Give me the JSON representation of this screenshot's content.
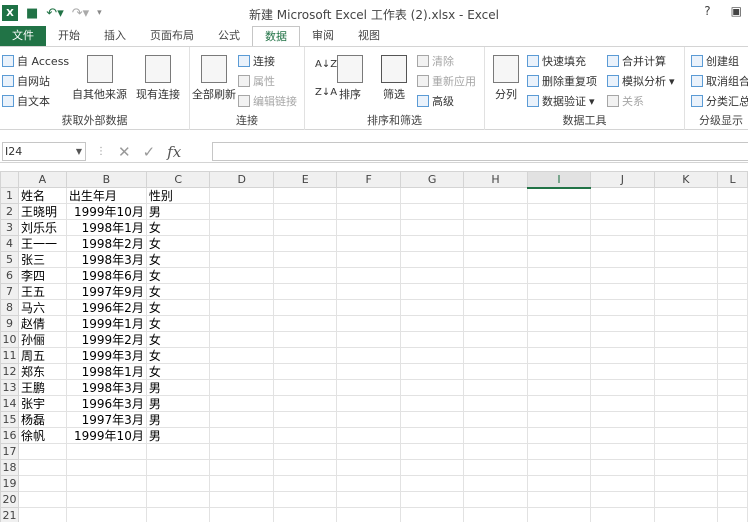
{
  "window": {
    "title": "新建 Microsoft Excel 工作表 (2).xlsx - Excel",
    "help": "?",
    "min_icon": "minimize-icon"
  },
  "tabs": [
    {
      "label": "文件"
    },
    {
      "label": "开始"
    },
    {
      "label": "插入"
    },
    {
      "label": "页面布局"
    },
    {
      "label": "公式"
    },
    {
      "label": "数据"
    },
    {
      "label": "审阅"
    },
    {
      "label": "视图"
    }
  ],
  "ribbon": {
    "ext_data": {
      "access": "自 Access",
      "web": "自网站",
      "text": "自文本",
      "other": "自其他来源",
      "existing": "现有连接",
      "label": "获取外部数据"
    },
    "connections": {
      "refresh": "全部刷新",
      "connections": "连接",
      "props": "属性",
      "edit_links": "编辑链接",
      "label": "连接"
    },
    "sort_filter": {
      "sort": "排序",
      "filter": "筛选",
      "clear": "清除",
      "reapply": "重新应用",
      "advanced": "高级",
      "label": "排序和筛选"
    },
    "data_tools": {
      "split": "分列",
      "flash_fill": "快速填充",
      "remove_dup": "删除重复项",
      "validation": "数据验证",
      "consolidate": "合并计算",
      "whatif": "模拟分析",
      "relations": "关系",
      "label": "数据工具"
    },
    "outline": {
      "group": "创建组",
      "ungroup": "取消组合",
      "subtotal": "分类汇总",
      "label": "分级显示"
    }
  },
  "formula_bar": {
    "namebox": "I24",
    "fx": "fx",
    "value": ""
  },
  "columns": [
    "A",
    "B",
    "C",
    "D",
    "E",
    "F",
    "G",
    "H",
    "I",
    "J",
    "K",
    "L"
  ],
  "rows": [
    [
      "姓名",
      "出生年月",
      "性别"
    ],
    [
      "王晓明",
      "1999年10月",
      "男"
    ],
    [
      "刘乐乐",
      "1998年1月",
      "女"
    ],
    [
      "王一一",
      "1998年2月",
      "女"
    ],
    [
      "张三",
      "1998年3月",
      "女"
    ],
    [
      "李四",
      "1998年6月",
      "女"
    ],
    [
      "王五",
      "1997年9月",
      "女"
    ],
    [
      "马六",
      "1996年2月",
      "女"
    ],
    [
      "赵倩",
      "1999年1月",
      "女"
    ],
    [
      "孙俪",
      "1999年2月",
      "女"
    ],
    [
      "周五",
      "1999年3月",
      "女"
    ],
    [
      "郑东",
      "1998年1月",
      "女"
    ],
    [
      "王鹏",
      "1998年3月",
      "男"
    ],
    [
      "张宇",
      "1996年3月",
      "男"
    ],
    [
      "杨磊",
      "1997年3月",
      "男"
    ],
    [
      "徐帆",
      "1999年10月",
      "男"
    ],
    [
      "",
      "",
      ""
    ],
    [
      "",
      "",
      ""
    ],
    [
      "",
      "",
      ""
    ],
    [
      "",
      "",
      ""
    ],
    [
      "",
      "",
      ""
    ]
  ],
  "selected_column": "I",
  "colors": {
    "accent": "#217346"
  }
}
